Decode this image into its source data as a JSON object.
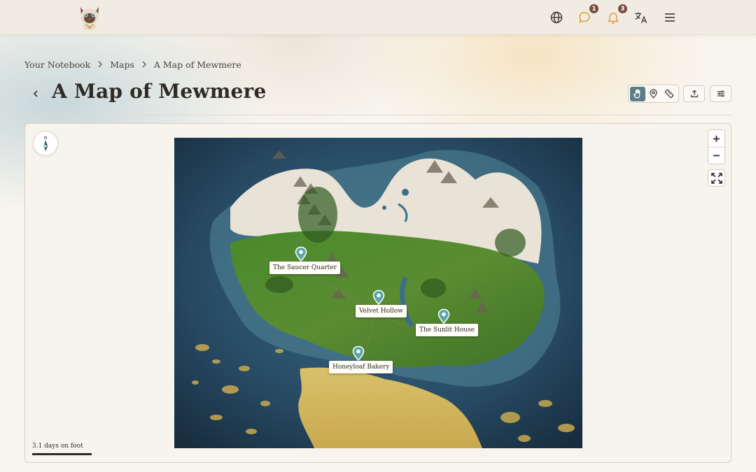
{
  "header": {
    "logo_icon": "siamese-cat-logo",
    "icons": [
      {
        "name": "globe-icon"
      },
      {
        "name": "chat-icon",
        "badge": "1"
      },
      {
        "name": "bell-icon",
        "badge": "3"
      },
      {
        "name": "translate-icon"
      },
      {
        "name": "menu-icon"
      }
    ]
  },
  "breadcrumb": {
    "items": [
      "Your Notebook",
      "Maps",
      "A Map of Mewmere"
    ]
  },
  "page": {
    "title": "A Map of Mewmere"
  },
  "toolbar": {
    "tools": [
      {
        "name": "hand-icon",
        "active": true
      },
      {
        "name": "pin-icon",
        "active": false
      },
      {
        "name": "ruler-icon",
        "active": false
      }
    ],
    "export_icon": "upload-icon",
    "settings_icon": "sliders-icon"
  },
  "map": {
    "zoom_in": "+",
    "zoom_out": "−",
    "markers": [
      {
        "label": "The Saucer Quarter"
      },
      {
        "label": "Velvet Hollow"
      },
      {
        "label": "The Sunlit House"
      },
      {
        "label": "Honeyloaf Bakery"
      }
    ],
    "scale_text": "3.1 days on foot"
  },
  "colors": {
    "accent": "#5f7f88",
    "badge": "#7a4a3e",
    "icon_orange": "#e39a3a",
    "marker": "#5aa5ad"
  }
}
